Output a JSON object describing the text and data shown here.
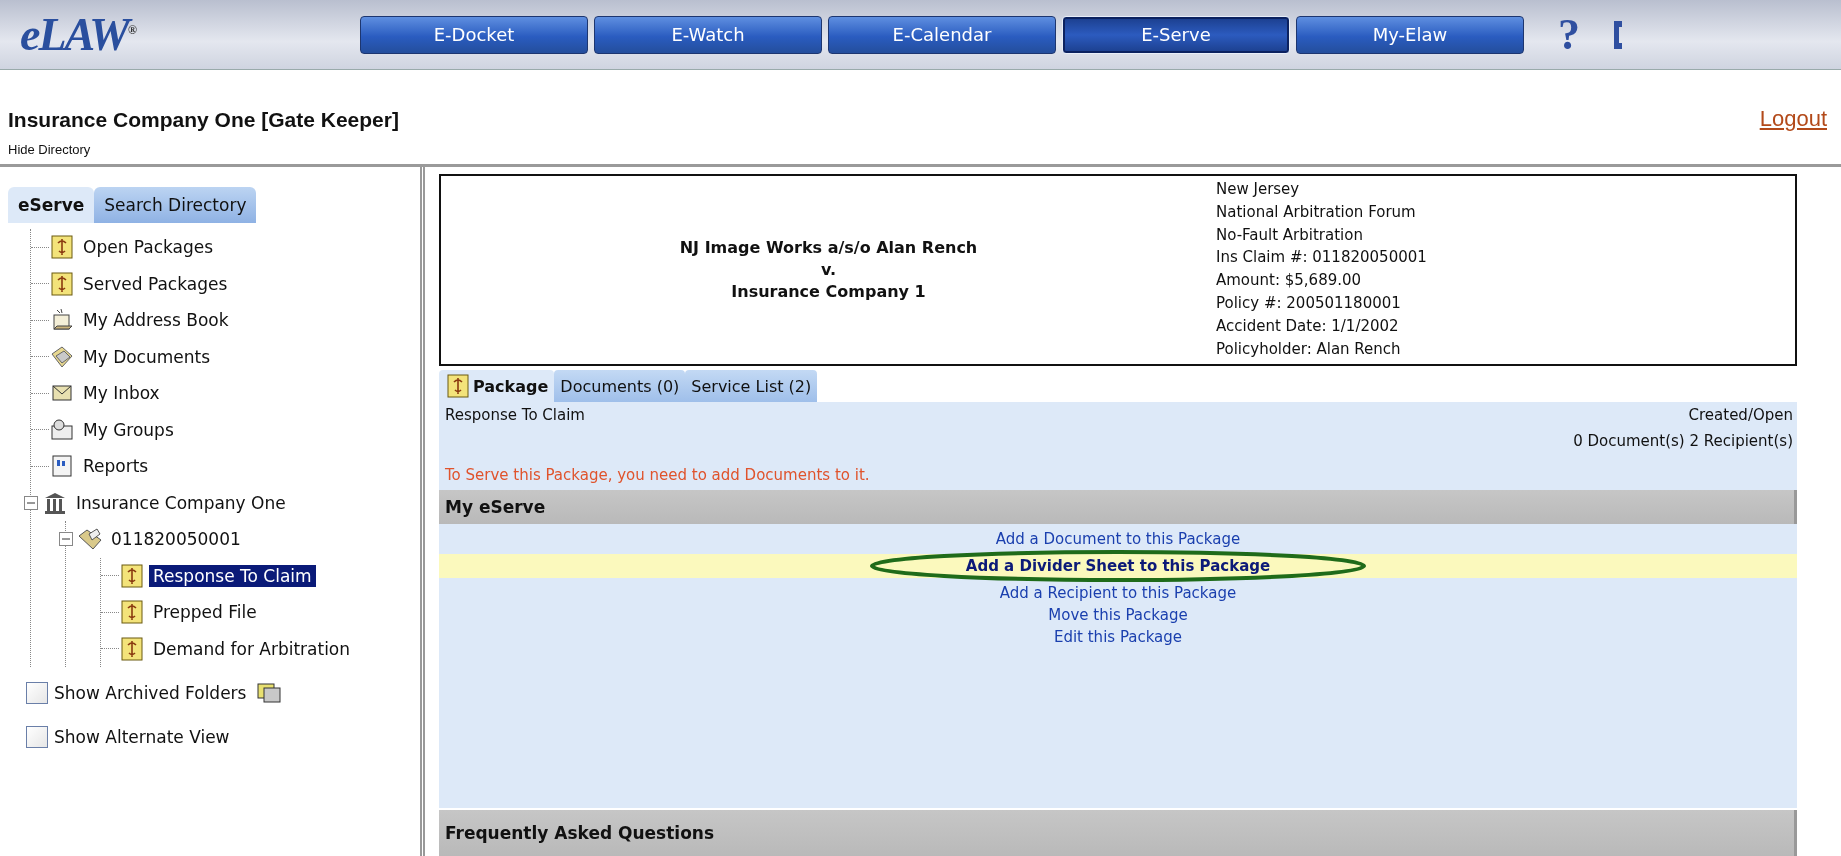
{
  "logo": {
    "text": "eLAW",
    "mark": "®"
  },
  "nav": [
    {
      "label": "E-Docket",
      "selected": false
    },
    {
      "label": "E-Watch",
      "selected": false
    },
    {
      "label": "E-Calendar",
      "selected": false
    },
    {
      "label": "E-Serve",
      "selected": true
    },
    {
      "label": "My-Elaw",
      "selected": false
    }
  ],
  "help": "?",
  "account_title": "Insurance Company One [Gate Keeper]",
  "logout": "Logout",
  "hide_directory": "Hide Directory",
  "sidebar": {
    "tabs": [
      {
        "label": "eServe",
        "selected": true
      },
      {
        "label": "Search Directory",
        "selected": false
      }
    ],
    "tree": [
      {
        "label": "Open Packages",
        "kind": "package",
        "selected": false
      },
      {
        "label": "Served Packages",
        "kind": "package",
        "selected": false
      },
      {
        "label": "My Address Book",
        "kind": "address-book",
        "selected": false
      },
      {
        "label": "My Documents",
        "kind": "documents",
        "selected": false
      },
      {
        "label": "My Inbox",
        "kind": "inbox",
        "selected": false
      },
      {
        "label": "My Groups",
        "kind": "groups",
        "selected": false
      },
      {
        "label": "Reports",
        "kind": "reports",
        "selected": false
      },
      {
        "label": "Insurance Company One",
        "kind": "building",
        "selected": false,
        "expanded": true,
        "children": [
          {
            "label": "011820050001",
            "kind": "case",
            "selected": false,
            "expanded": true,
            "children": [
              {
                "label": "Response To Claim",
                "kind": "package",
                "selected": true
              },
              {
                "label": "Prepped File",
                "kind": "package",
                "selected": false
              },
              {
                "label": "Demand for Arbitration",
                "kind": "package",
                "selected": false
              }
            ]
          }
        ]
      }
    ],
    "options": [
      {
        "label": "Show Archived Folders",
        "checked": false,
        "kind": "with-icon"
      },
      {
        "label": "Show Alternate View",
        "checked": false,
        "kind": "plain"
      }
    ]
  },
  "case_header": {
    "parties": [
      "NJ Image Works a/s/o Alan Rench",
      "v.",
      "Insurance Company 1"
    ],
    "details": [
      "New Jersey",
      "National Arbitration Forum",
      "No-Fault Arbitration",
      "Ins Claim #: 011820050001",
      "Amount: $5,689.00",
      "Policy #: 200501180001",
      "Accident Date: 1/1/2002",
      "Policyholder: Alan Rench"
    ]
  },
  "package_tabs": [
    {
      "label": "Package",
      "selected": true
    },
    {
      "label": "Documents (0)",
      "selected": false
    },
    {
      "label": "Service List (2)",
      "selected": false
    }
  ],
  "package": {
    "name": "Response To Claim",
    "status": "Created/Open",
    "counts": "0 Document(s) 2 Recipient(s)",
    "warning": "To Serve this Package, you need to add Documents to it."
  },
  "my_eserve": {
    "title": "My eServe",
    "actions": [
      {
        "label": "Add a Document to this Package",
        "highlighted": false,
        "circled": false
      },
      {
        "label": "Add a Divider Sheet to this Package",
        "highlighted": true,
        "circled": true
      },
      {
        "label": "Add a Recipient to this Package",
        "highlighted": false,
        "circled": false
      },
      {
        "label": "Move this Package",
        "highlighted": false,
        "circled": false
      },
      {
        "label": "Edit this Package",
        "highlighted": false,
        "circled": false
      }
    ]
  },
  "faq": {
    "title": "Frequently Asked Questions"
  }
}
